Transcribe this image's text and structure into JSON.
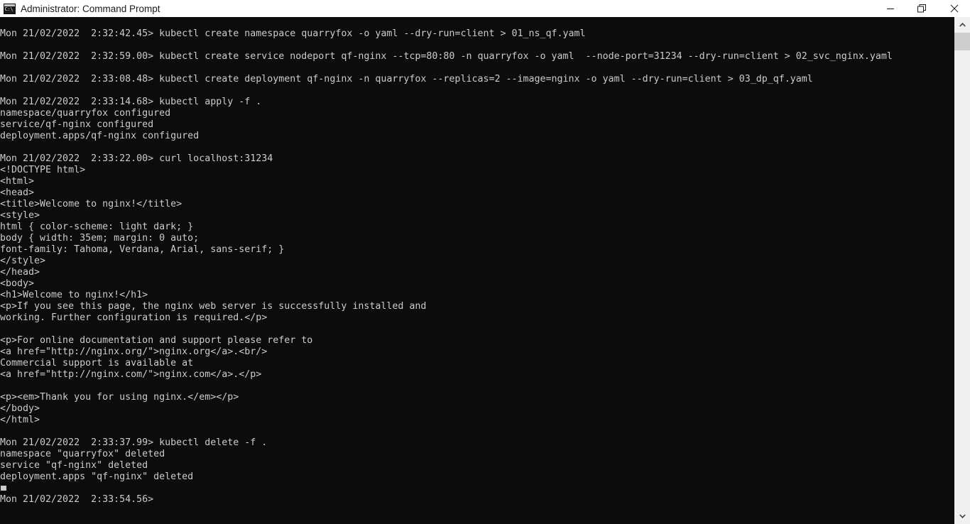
{
  "window": {
    "title": "Administrator: Command Prompt",
    "icon": "command-prompt-icon",
    "icon_text": "C:\\",
    "background_color": "#0c0c0c",
    "foreground_color": "#cccccc",
    "titlebar_background": "#ffffff",
    "controls": {
      "minimize_label": "Minimize",
      "maximize_label": "Restore",
      "close_label": "Close"
    }
  },
  "scrollbar": {
    "up_arrow_label": "Scroll up",
    "down_arrow_label": "Scroll down",
    "thumb_label": "Scroll thumb"
  },
  "terminal": {
    "cursor": "block-cursor",
    "lines": [
      "",
      "Mon 21/02/2022  2:32:42.45> kubectl create namespace quarryfox -o yaml --dry-run=client > 01_ns_qf.yaml",
      "",
      "Mon 21/02/2022  2:32:59.00> kubectl create service nodeport qf-nginx --tcp=80:80 -n quarryfox -o yaml  --node-port=31234 --dry-run=client > 02_svc_nginx.yaml",
      "",
      "Mon 21/02/2022  2:33:08.48> kubectl create deployment qf-nginx -n quarryfox --replicas=2 --image=nginx -o yaml --dry-run=client > 03_dp_qf.yaml",
      "",
      "Mon 21/02/2022  2:33:14.68> kubectl apply -f .",
      "namespace/quarryfox configured",
      "service/qf-nginx configured",
      "deployment.apps/qf-nginx configured",
      "",
      "Mon 21/02/2022  2:33:22.00> curl localhost:31234",
      "<!DOCTYPE html>",
      "<html>",
      "<head>",
      "<title>Welcome to nginx!</title>",
      "<style>",
      "html { color-scheme: light dark; }",
      "body { width: 35em; margin: 0 auto;",
      "font-family: Tahoma, Verdana, Arial, sans-serif; }",
      "</style>",
      "</head>",
      "<body>",
      "<h1>Welcome to nginx!</h1>",
      "<p>If you see this page, the nginx web server is successfully installed and",
      "working. Further configuration is required.</p>",
      "",
      "<p>For online documentation and support please refer to",
      "<a href=\"http://nginx.org/\">nginx.org</a>.<br/>",
      "Commercial support is available at",
      "<a href=\"http://nginx.com/\">nginx.com</a>.</p>",
      "",
      "<p><em>Thank you for using nginx.</em></p>",
      "</body>",
      "</html>",
      "",
      "Mon 21/02/2022  2:33:37.99> kubectl delete -f .",
      "namespace \"quarryfox\" deleted",
      "service \"qf-nginx\" deleted",
      "deployment.apps \"qf-nginx\" deleted",
      "",
      "Mon 21/02/2022  2:33:54.56> "
    ],
    "cursor_line_index": 41
  }
}
